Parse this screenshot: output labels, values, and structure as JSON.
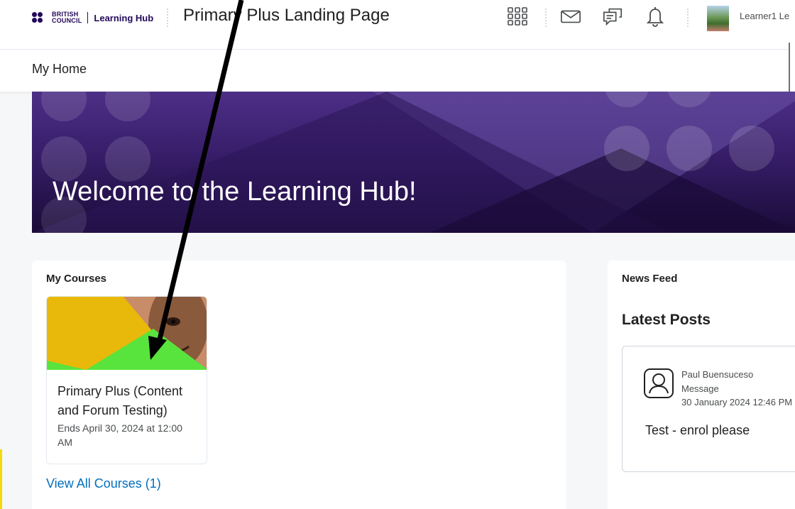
{
  "header": {
    "logo_line1": "BRITISH",
    "logo_line2": "COUNCIL",
    "logo_hub": "Learning Hub",
    "site_title": "Primary Plus Landing Page",
    "icons": [
      "apps-grid-icon",
      "mail-icon",
      "chat-icon",
      "bell-icon"
    ],
    "user_name": "Learner1 Le"
  },
  "nav": {
    "home_label": "My Home"
  },
  "banner": {
    "title": "Welcome to the Learning Hub!"
  },
  "my_courses": {
    "widget_title": "My Courses",
    "course": {
      "name": "Primary Plus (Content and Forum Testing)",
      "end_date": "Ends April 30, 2024 at 12:00 AM"
    },
    "view_all_label": "View All Courses (1)"
  },
  "news_feed": {
    "widget_title": "News Feed",
    "heading": "Latest Posts",
    "post": {
      "author": "Paul Buensuceso",
      "type": "Message",
      "timestamp": "30 January 2024 12:46 PM",
      "body": "Test - enrol please"
    }
  },
  "colors": {
    "brand": "#23085a",
    "link": "#006fbf",
    "banner_purple": "#3a1f6d",
    "course_yellow": "#e8b90a",
    "course_green": "#59e33d",
    "annotation_arrow": "#000000"
  }
}
